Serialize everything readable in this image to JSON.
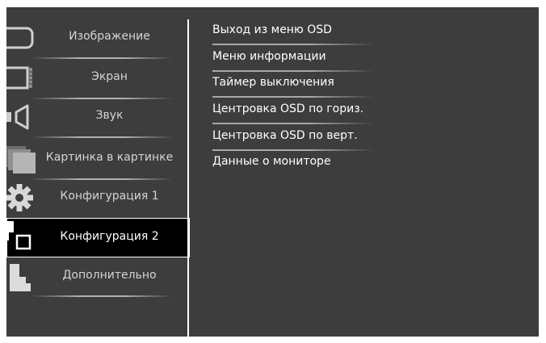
{
  "main_menu": {
    "items": [
      {
        "label": "Изображение",
        "icon": "picture-icon"
      },
      {
        "label": "Экран",
        "icon": "screen-icon"
      },
      {
        "label": "Звук",
        "icon": "speaker-icon"
      },
      {
        "label": "Картинка в картинке",
        "icon": "pip-icon"
      },
      {
        "label": "Конфигурация 1",
        "icon": "gear-icon"
      },
      {
        "label": "Конфигурация 2",
        "icon": "config2-icon",
        "selected": true
      },
      {
        "label": "Дополнительно",
        "icon": "advanced-icon"
      }
    ]
  },
  "sub_menu": {
    "items": [
      {
        "label": "Выход из меню OSD"
      },
      {
        "label": "Меню информации"
      },
      {
        "label": "Таймер выключения"
      },
      {
        "label": "Центровка OSD по гориз."
      },
      {
        "label": "Центровка OSD по верт."
      },
      {
        "label": "Данные о мониторе"
      }
    ]
  },
  "colors": {
    "background": "#3d3d3d",
    "selected_background": "#000000",
    "text": "#ffffff"
  }
}
